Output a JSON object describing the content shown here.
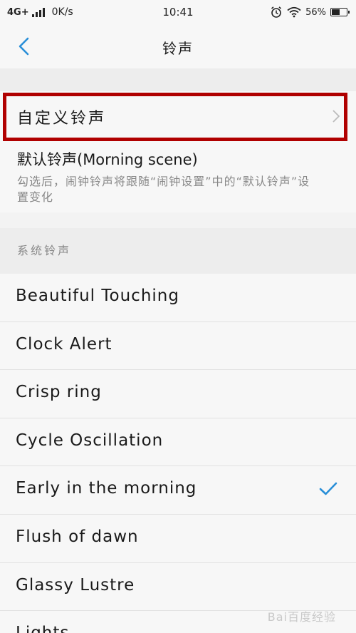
{
  "status_bar": {
    "network": "4G+",
    "speed": "0K/s",
    "time": "10:41",
    "battery_percent": "56%",
    "battery_level": 0.56
  },
  "header": {
    "title": "铃声"
  },
  "custom_ringtone": {
    "label": "自定义铃声"
  },
  "default_ringtone": {
    "title": "默认铃声(Morning scene)",
    "description": "勾选后，闹钟铃声将跟随“闹钟设置”中的“默认铃声”设置变化"
  },
  "system_section": {
    "label": "系统铃声"
  },
  "ringtones": [
    {
      "name": "Beautiful Touching",
      "selected": false
    },
    {
      "name": "Clock Alert",
      "selected": false
    },
    {
      "name": "Crisp ring",
      "selected": false
    },
    {
      "name": "Cycle Oscillation",
      "selected": false
    },
    {
      "name": "Early in the morning",
      "selected": true
    },
    {
      "name": "Flush of dawn",
      "selected": false
    },
    {
      "name": "Glassy Lustre",
      "selected": false
    },
    {
      "name": "Lights",
      "selected": false
    }
  ],
  "colors": {
    "accent": "#2a8fd8",
    "highlight_border": "#b00000"
  },
  "watermark": "Bai百度经验"
}
